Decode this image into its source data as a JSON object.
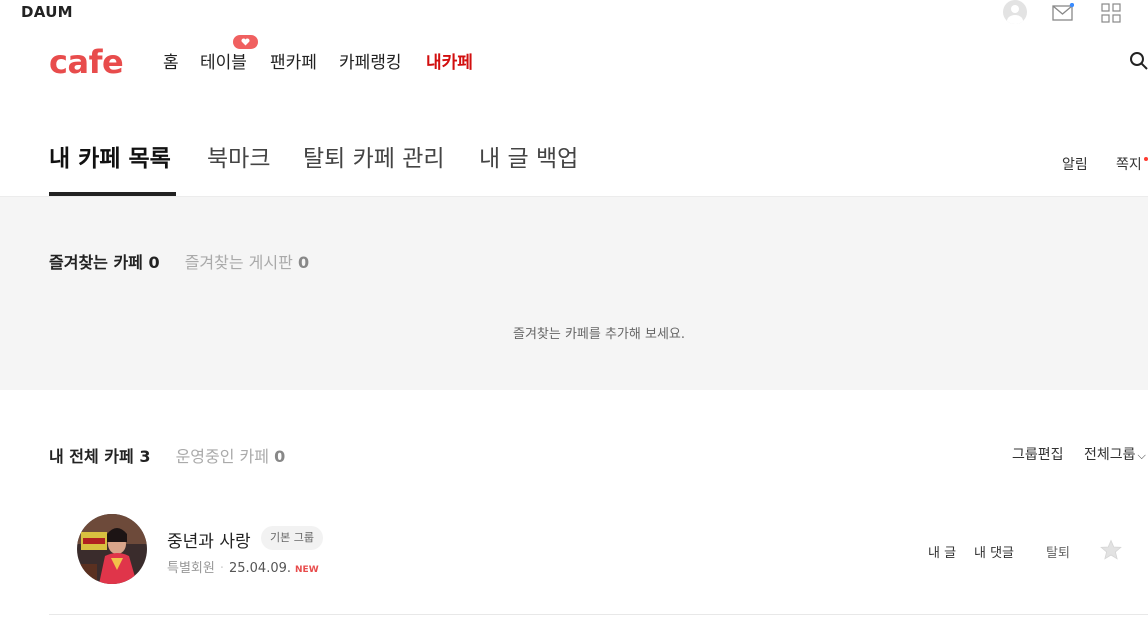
{
  "top": {
    "logo": "DAUM",
    "icons": [
      "avatar-icon",
      "mail-icon",
      "apps-grid-icon"
    ]
  },
  "nav": {
    "logo": "cafe",
    "items": [
      {
        "label": "홈"
      },
      {
        "label": "테이블"
      },
      {
        "label": "팬카페"
      },
      {
        "label": "카페랭킹"
      },
      {
        "label": "내카페",
        "active": true
      }
    ],
    "search_icon": "search-icon",
    "accent_color": "#d20f0f"
  },
  "tabs": {
    "items": [
      {
        "label": "내 카페 목록",
        "active": true
      },
      {
        "label": "북마크"
      },
      {
        "label": "탈퇴 카페 관리"
      },
      {
        "label": "내 글 백업"
      }
    ],
    "right": {
      "alerts": "알림",
      "messages": "쪽지"
    }
  },
  "favorites": {
    "tabs": [
      {
        "label": "즐겨찾는 카페",
        "count": "0",
        "active": true
      },
      {
        "label": "즐겨찾는 게시판",
        "count": "0"
      }
    ],
    "empty_message": "즐겨찾는 카페를 추가해 보세요."
  },
  "my_cafes": {
    "tabs": [
      {
        "label": "내 전체 카페",
        "count": "3",
        "active": true
      },
      {
        "label": "운영중인 카페",
        "count": "0"
      }
    ],
    "group_edit": "그룹편집",
    "group_select": "전체그룹",
    "rows": [
      {
        "name": "중년과 사랑",
        "group": "기본 그룹",
        "member_level": "특별회원",
        "date": "25.04.09.",
        "badge": "NEW",
        "actions": {
          "my_posts": "내 글",
          "my_comments": "내 댓글",
          "leave": "탈퇴"
        }
      }
    ]
  },
  "colors": {
    "brand": "#e84c4c",
    "panel_bg": "#f5f5f5"
  }
}
